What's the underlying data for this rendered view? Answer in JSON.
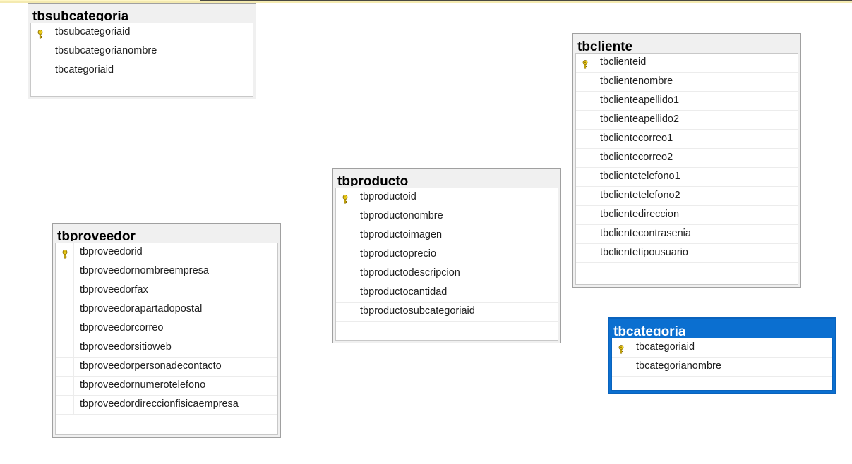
{
  "diagram": {
    "tables": [
      {
        "id": "tbsubcategoria",
        "name": "tbsubcategoria",
        "selected": false,
        "columns": [
          {
            "name": "tbsubcategoriaid",
            "primary_key": true
          },
          {
            "name": "tbsubcategorianombre",
            "primary_key": false
          },
          {
            "name": "tbcategoriaid",
            "primary_key": false
          }
        ]
      },
      {
        "id": "tbcliente",
        "name": "tbcliente",
        "selected": false,
        "columns": [
          {
            "name": "tbclienteid",
            "primary_key": true
          },
          {
            "name": "tbclientenombre",
            "primary_key": false
          },
          {
            "name": "tbclienteapellido1",
            "primary_key": false
          },
          {
            "name": "tbclienteapellido2",
            "primary_key": false
          },
          {
            "name": "tbclientecorreo1",
            "primary_key": false
          },
          {
            "name": "tbclientecorreo2",
            "primary_key": false
          },
          {
            "name": "tbclientetelefono1",
            "primary_key": false
          },
          {
            "name": "tbclientetelefono2",
            "primary_key": false
          },
          {
            "name": "tbclientedireccion",
            "primary_key": false
          },
          {
            "name": "tbclientecontrasenia",
            "primary_key": false
          },
          {
            "name": "tbclientetipousuario",
            "primary_key": false
          }
        ]
      },
      {
        "id": "tbproducto",
        "name": "tbproducto",
        "selected": false,
        "columns": [
          {
            "name": "tbproductoid",
            "primary_key": true
          },
          {
            "name": "tbproductonombre",
            "primary_key": false
          },
          {
            "name": "tbproductoimagen",
            "primary_key": false
          },
          {
            "name": "tbproductoprecio",
            "primary_key": false
          },
          {
            "name": "tbproductodescripcion",
            "primary_key": false
          },
          {
            "name": "tbproductocantidad",
            "primary_key": false
          },
          {
            "name": "tbproductosubcategoriaid",
            "primary_key": false
          }
        ]
      },
      {
        "id": "tbproveedor",
        "name": "tbproveedor",
        "selected": false,
        "columns": [
          {
            "name": "tbproveedorid",
            "primary_key": true
          },
          {
            "name": "tbproveedornombreempresa",
            "primary_key": false
          },
          {
            "name": "tbproveedorfax",
            "primary_key": false
          },
          {
            "name": "tbproveedorapartadopostal",
            "primary_key": false
          },
          {
            "name": "tbproveedorcorreo",
            "primary_key": false
          },
          {
            "name": "tbproveedorsitioweb",
            "primary_key": false
          },
          {
            "name": "tbproveedorpersonadecontacto",
            "primary_key": false
          },
          {
            "name": "tbproveedornumerotelefono",
            "primary_key": false
          },
          {
            "name": "tbproveedordireccionfisicaempresa",
            "primary_key": false
          }
        ]
      },
      {
        "id": "tbcategoria",
        "name": "tbcategoria",
        "selected": true,
        "columns": [
          {
            "name": "tbcategoriaid",
            "primary_key": true
          },
          {
            "name": "tbcategorianombre",
            "primary_key": false
          }
        ]
      }
    ],
    "colors": {
      "selected_header": "#0b6fd0",
      "header": "#f0f0f0",
      "key_icon": "#f2d21b"
    },
    "icons": {
      "primary_key": "key-icon"
    }
  }
}
